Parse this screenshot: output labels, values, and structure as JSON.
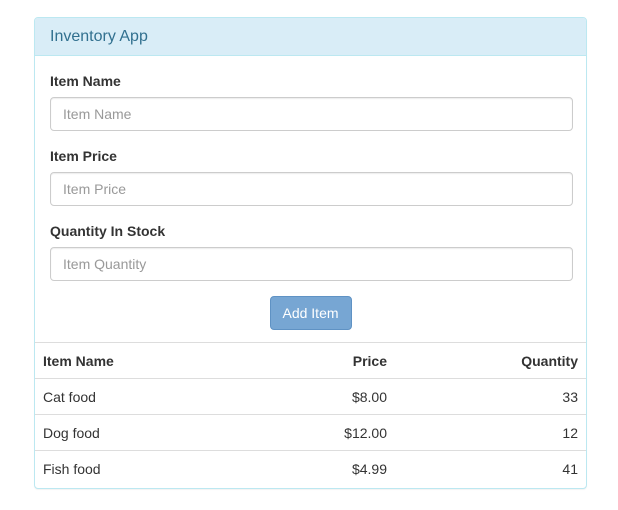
{
  "app": {
    "title": "Inventory App"
  },
  "form": {
    "item_name": {
      "label": "Item Name",
      "placeholder": "Item Name",
      "value": ""
    },
    "item_price": {
      "label": "Item Price",
      "placeholder": "Item Price",
      "value": ""
    },
    "quantity": {
      "label": "Quantity In Stock",
      "placeholder": "Item Quantity",
      "value": ""
    },
    "submit_label": "Add Item"
  },
  "colors": {
    "heading_bg": "#d9edf7",
    "heading_text": "#31708f",
    "button_bg": "#77a6d3"
  },
  "table": {
    "headers": [
      "Item Name",
      "Price",
      "Quantity"
    ],
    "rows": [
      [
        "Cat food",
        "$8.00",
        "33"
      ],
      [
        "Dog food",
        "$12.00",
        "12"
      ],
      [
        "Fish food",
        "$4.99",
        "41"
      ]
    ]
  }
}
